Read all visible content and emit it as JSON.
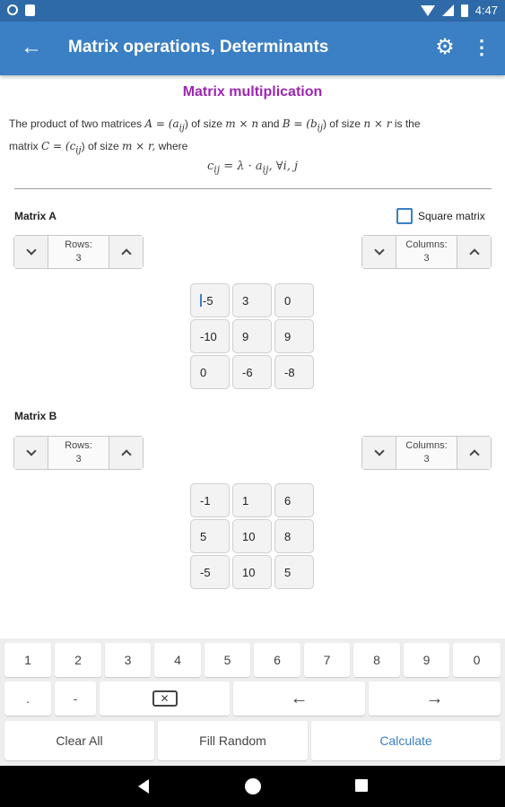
{
  "status": {
    "time": "4:47"
  },
  "appbar": {
    "title": "Matrix operations, Determinants"
  },
  "section": {
    "title": "Matrix multiplication",
    "desc_line1_a": "The product of two matrices",
    "desc_A": "A = (a",
    "desc_A_sub": "ij",
    "desc_line1_b": ") of size",
    "desc_mn": "m × n",
    "desc_and": "and",
    "desc_B": "B = (b",
    "desc_B_sub": "ij",
    "desc_line1_c": ") of size",
    "desc_nr": "n × r",
    "desc_is": "is the",
    "desc_line2_a": "matrix",
    "desc_C": "C = (c",
    "desc_C_sub": "ij",
    "desc_line2_b": ") of size",
    "desc_mr": "m × r,",
    "desc_line2_c": "where",
    "formula": "c",
    "formula_sub": "ij",
    "formula_rest": " = λ · a",
    "formula_sub2": "ij",
    "formula_end": ", ∀i, j"
  },
  "matrixA": {
    "label": "Matrix A",
    "square_label": "Square matrix",
    "rows_label": "Rows:",
    "rows_value": "3",
    "cols_label": "Columns:",
    "cols_value": "3",
    "cells": [
      "-5",
      "3",
      "0",
      "-10",
      "9",
      "9",
      "0",
      "-6",
      "-8"
    ]
  },
  "matrixB": {
    "label": "Matrix B",
    "rows_label": "Rows:",
    "rows_value": "3",
    "cols_label": "Columns:",
    "cols_value": "3",
    "cells": [
      "-1",
      "1",
      "6",
      "5",
      "10",
      "8",
      "-5",
      "10",
      "5"
    ]
  },
  "keyboard": {
    "digits": [
      "1",
      "2",
      "3",
      "4",
      "5",
      "6",
      "7",
      "8",
      "9",
      "0"
    ],
    "dot": ".",
    "minus": "-",
    "left_arrow": "←",
    "right_arrow": "→",
    "clear_all": "Clear All",
    "fill_random": "Fill Random",
    "calculate": "Calculate"
  },
  "icons": {
    "back": "arrow-back-icon",
    "settings": "gear-icon",
    "menu": "more-vert-icon",
    "backspace": "backspace-icon"
  },
  "colors": {
    "appbar": "#3b7fc4",
    "statusbar": "#2f6aa8",
    "title_accent": "#9c27b0"
  }
}
